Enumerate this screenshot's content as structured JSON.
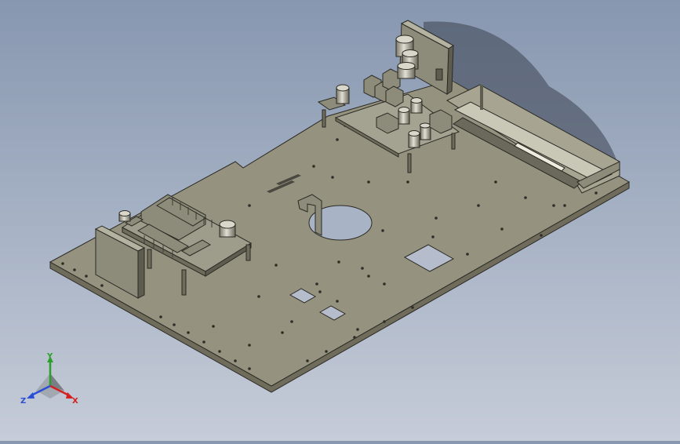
{
  "viewport": {
    "model": "plate-assembly-isometric",
    "background_top": "#8797b0",
    "background_bottom": "#c6ccd8"
  },
  "triad": {
    "x_label": "X",
    "y_label": "Y",
    "z_label": "Z",
    "x_color": "#d42020",
    "y_color": "#2aa02a",
    "z_color": "#2a4fd4"
  },
  "colors": {
    "plate_top": "#95927f",
    "plate_side": "#6f6c5c",
    "component": "#8d8b79",
    "component_dark": "#5e5c4f",
    "edge": "#2b2a24"
  }
}
